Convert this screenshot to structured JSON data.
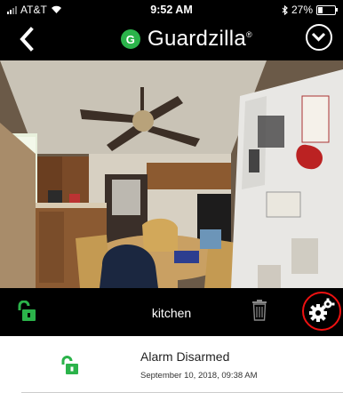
{
  "status_bar": {
    "carrier": "AT&T",
    "time": "9:52 AM",
    "battery": "27%",
    "battery_level": 0.27
  },
  "nav": {
    "brand_logo_letter": "G",
    "brand_name": "Guardzilla",
    "brand_mark": "®"
  },
  "camera": {
    "name": "kitchen"
  },
  "icons": {
    "back": "chevron-left-icon",
    "menu": "chevron-down-circle-icon",
    "lock": "unlocked-padlock-icon",
    "trash": "trash-icon",
    "settings": "gear-icon"
  },
  "event": {
    "title": "Alarm Disarmed",
    "timestamp": "September 10, 2018, 09:38 AM"
  },
  "colors": {
    "accent_green": "#2bb34a",
    "highlight_ring": "#e11111"
  }
}
